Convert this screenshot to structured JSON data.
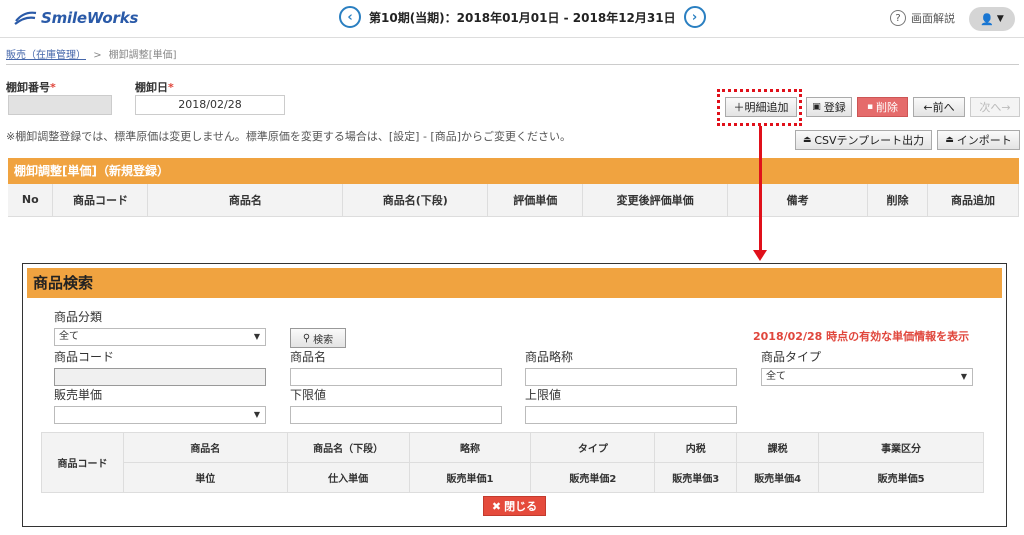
{
  "header": {
    "logo_text": "SmileWorks",
    "prev_icon": "chevron-left-icon",
    "next_icon": "chevron-right-icon",
    "period_text": "第10期(当期)：2018年01月01日 - 2018年12月31日",
    "help_text": "画面解説",
    "help_icon": "question-icon",
    "user_icon": "user-icon"
  },
  "breadcrumb": {
    "parent": "販売（在庫管理）",
    "separator": ">",
    "current": "棚卸調整[単価]"
  },
  "form": {
    "inventory_no_label": "棚卸番号",
    "inventory_date_label": "棚卸日",
    "required_mark": "*",
    "inventory_no_value": "",
    "inventory_date_value": "2018/02/28",
    "note": "※棚卸調整登録では、標準原価は変更しません。標準原価を変更する場合は、[設定] - [商品]からご変更ください。"
  },
  "toolbar": {
    "add_detail_label": "＋明細追加",
    "register_label": "登録",
    "delete_label": "削除",
    "prev_label": "←前へ",
    "next_label": "次へ→",
    "csv_label": "CSVテンプレート出力",
    "import_label": "インポート"
  },
  "main_panel": {
    "title": "棚卸調整[単価]（新規登録）",
    "columns": [
      "No",
      "商品コード",
      "商品名",
      "商品名(下段)",
      "評価単価",
      "変更後評価単価",
      "備考",
      "削除",
      "商品追加"
    ]
  },
  "modal": {
    "title": "商品検索",
    "category_label": "商品分類",
    "category_value": "全て",
    "search_label": "検索",
    "info_text": "2018/02/28 時点の有効な単価情報を表示",
    "code_label": "商品コード",
    "name_label": "商品名",
    "abbr_label": "商品略称",
    "type_label": "商品タイプ",
    "type_value": "全て",
    "price_label": "販売単価",
    "price_value": "",
    "lower_label": "下限値",
    "upper_label": "上限値",
    "table": {
      "row_header": "商品コード",
      "row1": [
        "商品名",
        "商品名（下段）",
        "略称",
        "タイプ",
        "内税",
        "課税",
        "事業区分"
      ],
      "row2": [
        "単位",
        "仕入単価",
        "販売単価1",
        "販売単価2",
        "販売単価3",
        "販売単価4",
        "販売単価5"
      ]
    },
    "close_label": "閉じる"
  },
  "colors": {
    "accent_orange": "#f0a340",
    "brand_blue": "#2a5aa8",
    "danger_red": "#e54b3c",
    "highlight_red": "#e0101a"
  }
}
